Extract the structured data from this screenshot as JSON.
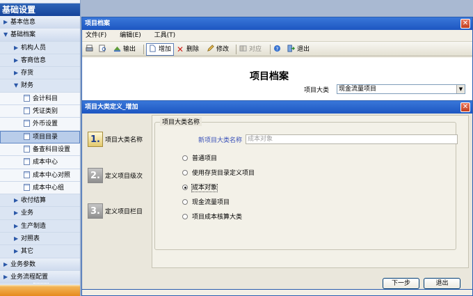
{
  "nav": {
    "title": "基础设置",
    "items": [
      {
        "label": "基本信息",
        "expanded": false
      },
      {
        "label": "基础档案",
        "expanded": true
      },
      {
        "label": "机构人员",
        "expanded": false
      },
      {
        "label": "客商信息",
        "expanded": false
      },
      {
        "label": "存货",
        "expanded": false
      },
      {
        "label": "财务",
        "expanded": true
      },
      {
        "label": "会计科目"
      },
      {
        "label": "凭证类别"
      },
      {
        "label": "外币设置"
      },
      {
        "label": "项目目录",
        "selected": true
      },
      {
        "label": "备查科目设置"
      },
      {
        "label": "成本中心"
      },
      {
        "label": "成本中心对照"
      },
      {
        "label": "成本中心组"
      },
      {
        "label": "收付结算",
        "expanded": false
      },
      {
        "label": "业务",
        "expanded": false
      },
      {
        "label": "生产制造",
        "expanded": false
      },
      {
        "label": "对照表",
        "expanded": false
      },
      {
        "label": "其它",
        "expanded": false
      },
      {
        "label": "业务参数",
        "expanded": false
      },
      {
        "label": "业务流程配置",
        "expanded": false
      }
    ]
  },
  "archive_window": {
    "title": "项目档案",
    "menu": [
      "文件(F)",
      "编辑(E)",
      "工具(T)"
    ],
    "toolbar": {
      "output": "输出",
      "add": "增加",
      "delete": "删除",
      "modify": "修改",
      "compare": "对应",
      "exit": "退出"
    },
    "heading": "项目档案",
    "category_label": "项目大类",
    "category_value": "现金流量项目"
  },
  "wizard": {
    "title": "项目大类定义_增加",
    "steps": [
      {
        "number": "1.",
        "label": "项目大类名称",
        "active": true
      },
      {
        "number": "2.",
        "label": "定义项目级次",
        "active": false
      },
      {
        "number": "3.",
        "label": "定义项目栏目",
        "active": false
      }
    ],
    "group_title": "项目大类名称",
    "new_name_label": "新项目大类名称",
    "new_name_value": "成本对象",
    "options": [
      {
        "label": "普通项目",
        "checked": false
      },
      {
        "label": "使用存货目录定义项目",
        "checked": false
      },
      {
        "label": "成本对象",
        "checked": true
      },
      {
        "label": "现金流量项目",
        "checked": false
      },
      {
        "label": "项目成本核算大类",
        "checked": false
      }
    ],
    "next_button": "下一步",
    "exit_button": "退出"
  }
}
